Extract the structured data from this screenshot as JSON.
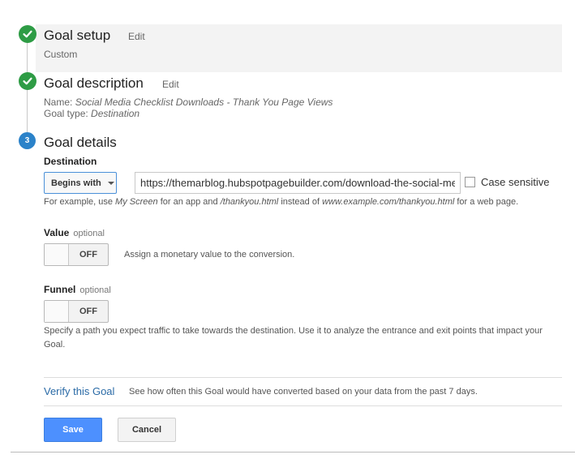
{
  "steps": [
    {
      "title": "Goal setup",
      "edit": "Edit",
      "summary": "Custom"
    },
    {
      "title": "Goal description",
      "edit": "Edit",
      "name_label": "Name:",
      "name_value": "Social Media Checklist Downloads - Thank You Page Views",
      "type_label": "Goal type:",
      "type_value": "Destination"
    },
    {
      "number": "3",
      "title": "Goal details"
    }
  ],
  "destination": {
    "label": "Destination",
    "match_type": "Begins with",
    "url_value": "https://themarblog.hubspotpagebuilder.com/download-the-social-media-checklist",
    "case_sensitive_label": "Case sensitive",
    "hint_1": "For example, use",
    "hint_2": "My Screen",
    "hint_3": "for an app and",
    "hint_4": "/thankyou.html",
    "hint_5": "instead of",
    "hint_6": "www.example.com/thankyou.html",
    "hint_7": "for a web page."
  },
  "value": {
    "label": "Value",
    "optional": "optional",
    "toggle_state": "OFF",
    "description": "Assign a monetary value to the conversion."
  },
  "funnel": {
    "label": "Funnel",
    "optional": "optional",
    "toggle_state": "OFF",
    "description_line1": "Specify a path you expect traffic to take towards the destination. Use it to analyze the entrance and exit points that impact your",
    "description_line2": "Goal."
  },
  "verify": {
    "link": "Verify this Goal",
    "description": "See how often this Goal would have converted based on your data from the past 7 days."
  },
  "actions": {
    "save": "Save",
    "cancel": "Cancel"
  },
  "colors": {
    "check": "#2e9c45",
    "step_number": "#2b82c9",
    "save_button": "#4d90fe",
    "link": "#2a6aa6"
  }
}
